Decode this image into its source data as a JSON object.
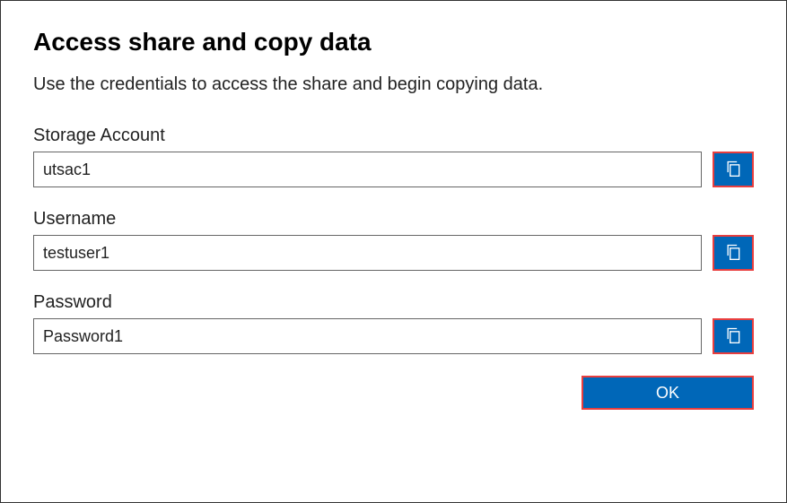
{
  "dialog": {
    "title": "Access share and copy data",
    "description": "Use the credentials to access the share and begin copying data."
  },
  "fields": {
    "storage_account": {
      "label": "Storage Account",
      "value": "utsac1"
    },
    "username": {
      "label": "Username",
      "value": "testuser1"
    },
    "password": {
      "label": "Password",
      "value": "Password1"
    }
  },
  "buttons": {
    "ok": "OK"
  },
  "icons": {
    "copy": "copy-icon"
  }
}
